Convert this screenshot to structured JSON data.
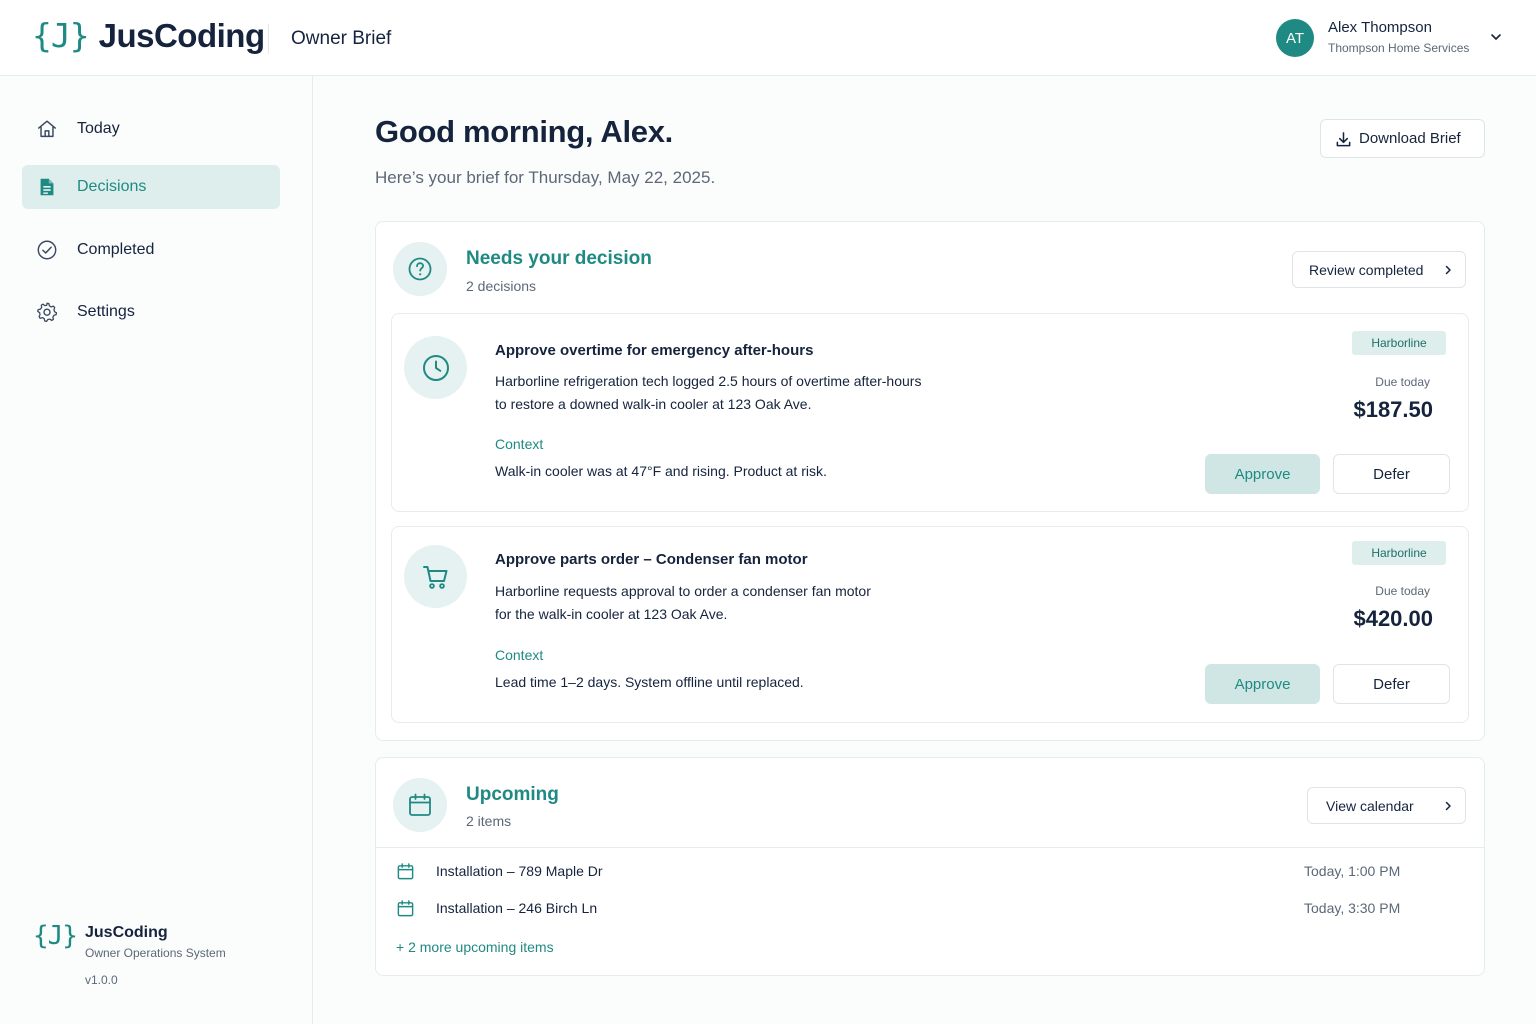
{
  "app": {
    "logo_mark": "{J}",
    "logo_text": "JusCoding",
    "page_title": "Owner Brief",
    "accent_color": "#1f8a83"
  },
  "user": {
    "initials": "AT",
    "name": "Alex Thompson",
    "company": "Thompson Home Services"
  },
  "sidebar": {
    "items": [
      {
        "label": "Today",
        "icon": "home-icon",
        "active": false
      },
      {
        "label": "Decisions",
        "icon": "document-icon",
        "active": true
      },
      {
        "label": "Completed",
        "icon": "check-circle-icon",
        "active": false
      },
      {
        "label": "Settings",
        "icon": "gear-icon",
        "active": false
      }
    ],
    "footer": {
      "logo_mark": "{J}",
      "brand": "JusCoding",
      "subtitle": "Owner Operations System",
      "version": "v1.0.0"
    }
  },
  "main": {
    "greeting": "Good morning, Alex.",
    "subgreeting": "Here’s your brief for Thursday, May 22, 2025.",
    "download_label": "Download Brief"
  },
  "decisions": {
    "title": "Needs your decision",
    "count": "2 decisions",
    "review_label": "Review completed",
    "items": [
      {
        "icon": "clock-icon",
        "title": "Approve overtime for emergency after-hours",
        "desc_line1": "Harborline refrigeration tech logged 2.5 hours of overtime after-hours",
        "desc_line2": "to restore a downed walk-in cooler at 123 Oak Ave.",
        "context_label": "Context",
        "context": "Walk-in cooler was at 47°F and rising. Product at risk.",
        "vendor": "Harborline",
        "due": "Due today",
        "amount": "$187.50",
        "approve_label": "Approve",
        "defer_label": "Defer"
      },
      {
        "icon": "cart-icon",
        "title": "Approve parts order – Condenser fan motor",
        "desc_line1": "Harborline requests approval to order a condenser fan motor",
        "desc_line2": "for the walk-in cooler at 123 Oak Ave.",
        "context_label": "Context",
        "context": "Lead time 1–2 days. System offline until replaced.",
        "vendor": "Harborline",
        "due": "Due today",
        "amount": "$420.00",
        "approve_label": "Approve",
        "defer_label": "Defer"
      }
    ]
  },
  "upcoming": {
    "title": "Upcoming",
    "count": "2 items",
    "calendar_label": "View calendar",
    "items": [
      {
        "label": "Installation – 789 Maple Dr",
        "time": "Today, 1:00 PM"
      },
      {
        "label": "Installation – 246 Birch Ln",
        "time": "Today, 3:30 PM"
      }
    ],
    "more_label": "+ 2 more upcoming items"
  }
}
